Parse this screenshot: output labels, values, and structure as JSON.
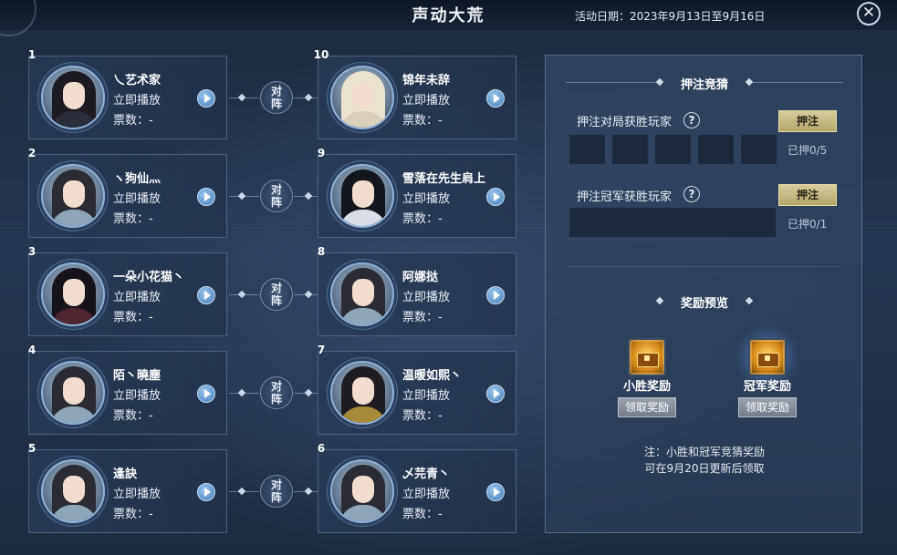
{
  "header": {
    "title": "声动大荒",
    "date_label": "活动日期：2023年9月13日至9月16日",
    "close_glyph": "✕"
  },
  "matchups": [
    {
      "left": {
        "rank": "1",
        "name": "乀艺术家",
        "play": "立即播放",
        "votes": "票数：-"
      },
      "right": {
        "rank": "10",
        "name": "锦年未辞",
        "play": "立即播放",
        "votes": "票数：-"
      },
      "versus": [
        "对",
        "阵"
      ]
    },
    {
      "left": {
        "rank": "2",
        "name": "ヽ狗仙灬",
        "play": "立即播放",
        "votes": "票数：-"
      },
      "right": {
        "rank": "9",
        "name": "雪落在先生肩上",
        "play": "立即播放",
        "votes": "票数：-"
      },
      "versus": [
        "对",
        "阵"
      ]
    },
    {
      "left": {
        "rank": "3",
        "name": "一朵小花猫丶",
        "play": "立即播放",
        "votes": "票数：-"
      },
      "right": {
        "rank": "8",
        "name": "阿娜挞",
        "play": "立即播放",
        "votes": "票数：-"
      },
      "versus": [
        "对",
        "阵"
      ]
    },
    {
      "left": {
        "rank": "4",
        "name": "陌丶曉塵",
        "play": "立即播放",
        "votes": "票数：-"
      },
      "right": {
        "rank": "7",
        "name": "温暖如熙丶",
        "play": "立即播放",
        "votes": "票数：-"
      },
      "versus": [
        "对",
        "阵"
      ]
    },
    {
      "left": {
        "rank": "5",
        "name": "逢訣",
        "play": "立即播放",
        "votes": "票数：-"
      },
      "right": {
        "rank": "6",
        "name": "乄芫青丶",
        "play": "立即播放",
        "votes": "票数：-"
      },
      "versus": [
        "对",
        "阵"
      ]
    }
  ],
  "betting": {
    "section_title": "押注竞猜",
    "round_bet": {
      "label": "押注对局获胜玩家",
      "button": "押注",
      "count": "已押0/5"
    },
    "champion_bet": {
      "label": "押注冠军获胜玩家",
      "button": "押注",
      "count": "已押0/1"
    },
    "help_glyph": "?"
  },
  "rewards": {
    "section_title": "奖励预览",
    "small": {
      "label": "小胜奖励",
      "button": "领取奖励",
      "icon": "treasure-chest-icon"
    },
    "champion": {
      "label": "冠军奖励",
      "button": "领取奖励",
      "icon": "treasure-chest-icon"
    },
    "note_line1": "注：小胜和冠军竞猜奖励",
    "note_line2": "可在9月20日更新后领取"
  },
  "colors": {
    "accent_gold": "#c9bc82",
    "play_blue": "#6fa3d6",
    "claim_gray": "#858d98"
  }
}
